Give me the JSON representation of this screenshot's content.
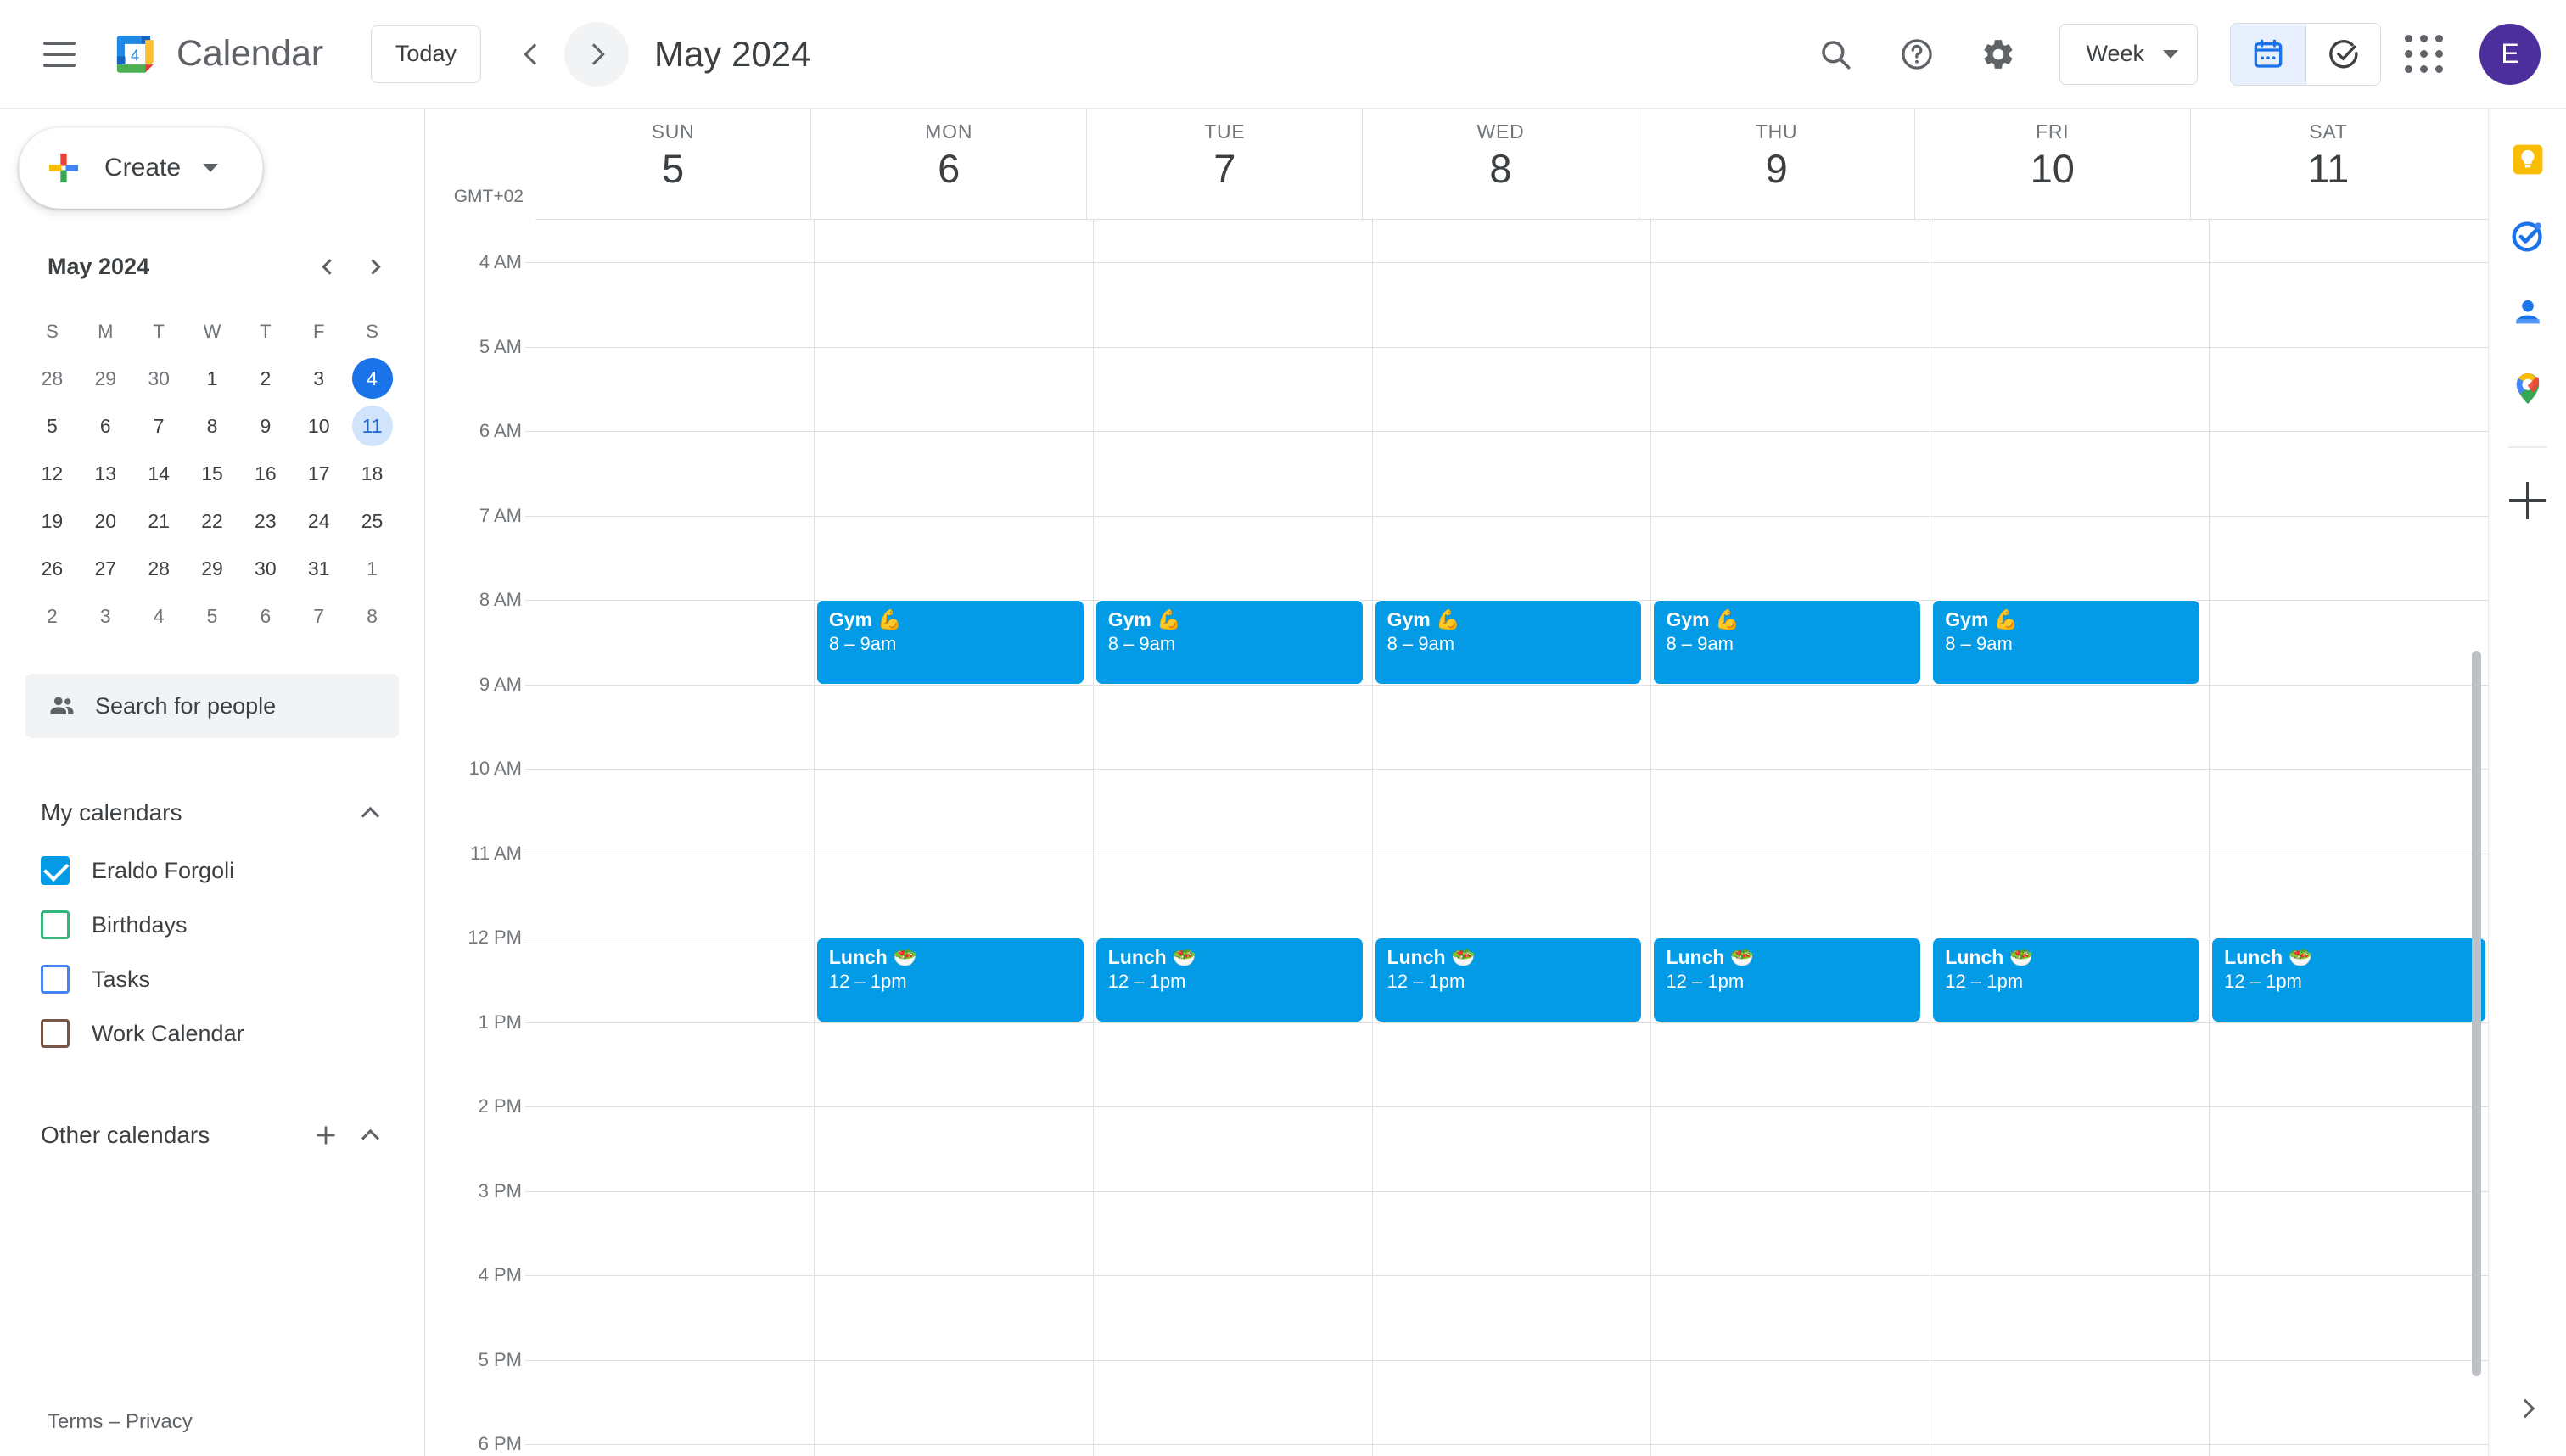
{
  "app": {
    "brand_title": "Calendar",
    "logo_day": "4"
  },
  "topbar": {
    "menu_icon": "hamburger-menu-icon",
    "today_label": "Today",
    "prev_icon": "chevron-left-icon",
    "next_icon": "chevron-right-icon",
    "period_title": "May 2024",
    "search_icon": "search-icon",
    "help_icon": "help-circle-icon",
    "settings_icon": "gear-icon",
    "view_label": "Week",
    "view_caret_icon": "chevron-down-icon",
    "calendar_view_icon": "calendar-icon",
    "tasks_view_icon": "check-circle-icon",
    "apps_icon": "apps-grid-icon",
    "avatar_initial": "E",
    "avatar_color": "#4c2e9c"
  },
  "sidebar": {
    "create_label": "Create",
    "create_caret_icon": "chevron-down-icon",
    "mini_calendar": {
      "title": "May 2024",
      "prev_icon": "chevron-left-icon",
      "next_icon": "chevron-right-icon",
      "dow": [
        "S",
        "M",
        "T",
        "W",
        "T",
        "F",
        "S"
      ],
      "weeks": [
        [
          {
            "d": "28",
            "s": "other"
          },
          {
            "d": "29",
            "s": "other"
          },
          {
            "d": "30",
            "s": "other"
          },
          {
            "d": "1",
            "s": ""
          },
          {
            "d": "2",
            "s": ""
          },
          {
            "d": "3",
            "s": ""
          },
          {
            "d": "4",
            "s": "today"
          }
        ],
        [
          {
            "d": "5",
            "s": ""
          },
          {
            "d": "6",
            "s": ""
          },
          {
            "d": "7",
            "s": ""
          },
          {
            "d": "8",
            "s": ""
          },
          {
            "d": "9",
            "s": ""
          },
          {
            "d": "10",
            "s": ""
          },
          {
            "d": "11",
            "s": "selected"
          }
        ],
        [
          {
            "d": "12",
            "s": ""
          },
          {
            "d": "13",
            "s": ""
          },
          {
            "d": "14",
            "s": ""
          },
          {
            "d": "15",
            "s": ""
          },
          {
            "d": "16",
            "s": ""
          },
          {
            "d": "17",
            "s": ""
          },
          {
            "d": "18",
            "s": ""
          }
        ],
        [
          {
            "d": "19",
            "s": ""
          },
          {
            "d": "20",
            "s": ""
          },
          {
            "d": "21",
            "s": ""
          },
          {
            "d": "22",
            "s": ""
          },
          {
            "d": "23",
            "s": ""
          },
          {
            "d": "24",
            "s": ""
          },
          {
            "d": "25",
            "s": ""
          }
        ],
        [
          {
            "d": "26",
            "s": ""
          },
          {
            "d": "27",
            "s": ""
          },
          {
            "d": "28",
            "s": ""
          },
          {
            "d": "29",
            "s": ""
          },
          {
            "d": "30",
            "s": ""
          },
          {
            "d": "31",
            "s": ""
          },
          {
            "d": "1",
            "s": "other"
          }
        ],
        [
          {
            "d": "2",
            "s": "other"
          },
          {
            "d": "3",
            "s": "other"
          },
          {
            "d": "4",
            "s": "other"
          },
          {
            "d": "5",
            "s": "other"
          },
          {
            "d": "6",
            "s": "other"
          },
          {
            "d": "7",
            "s": "other"
          },
          {
            "d": "8",
            "s": "other"
          }
        ]
      ]
    },
    "people_search": {
      "label": "Search for people",
      "icon": "people-icon"
    },
    "my_calendars": {
      "title": "My calendars",
      "collapse_icon": "chevron-up-icon",
      "items": [
        {
          "label": "Eraldo Forgoli",
          "color": "#039be5",
          "checked": true
        },
        {
          "label": "Birthdays",
          "color": "#33b679",
          "checked": false
        },
        {
          "label": "Tasks",
          "color": "#4285f4",
          "checked": false
        },
        {
          "label": "Work Calendar",
          "color": "#795548",
          "checked": false
        }
      ]
    },
    "other_calendars": {
      "title": "Other calendars",
      "add_icon": "plus-icon",
      "collapse_icon": "chevron-up-icon",
      "items": []
    },
    "footer": {
      "terms": "Terms",
      "separator": "–",
      "privacy": "Privacy"
    }
  },
  "grid": {
    "timezone": "GMT+02",
    "days": [
      {
        "dow": "SUN",
        "num": "5"
      },
      {
        "dow": "MON",
        "num": "6"
      },
      {
        "dow": "TUE",
        "num": "7"
      },
      {
        "dow": "WED",
        "num": "8"
      },
      {
        "dow": "THU",
        "num": "9"
      },
      {
        "dow": "FRI",
        "num": "10"
      },
      {
        "dow": "SAT",
        "num": "11"
      }
    ],
    "hours": [
      "4 AM",
      "5 AM",
      "6 AM",
      "7 AM",
      "8 AM",
      "9 AM",
      "10 AM",
      "11 AM",
      "12 PM",
      "1 PM",
      "2 PM",
      "3 PM",
      "4 PM",
      "5 PM",
      "6 PM"
    ],
    "events": [
      {
        "day": 1,
        "title": "Gym 💪",
        "time": "8 – 9am",
        "start_hour": "8 AM",
        "end_hour": "9 AM",
        "color": "#039be5",
        "full_width": false
      },
      {
        "day": 2,
        "title": "Gym 💪",
        "time": "8 – 9am",
        "start_hour": "8 AM",
        "end_hour": "9 AM",
        "color": "#039be5",
        "full_width": false
      },
      {
        "day": 3,
        "title": "Gym 💪",
        "time": "8 – 9am",
        "start_hour": "8 AM",
        "end_hour": "9 AM",
        "color": "#039be5",
        "full_width": false
      },
      {
        "day": 4,
        "title": "Gym 💪",
        "time": "8 – 9am",
        "start_hour": "8 AM",
        "end_hour": "9 AM",
        "color": "#039be5",
        "full_width": false
      },
      {
        "day": 5,
        "title": "Gym 💪",
        "time": "8 – 9am",
        "start_hour": "8 AM",
        "end_hour": "9 AM",
        "color": "#039be5",
        "full_width": false
      },
      {
        "day": 1,
        "title": "Lunch 🥗",
        "time": "12 – 1pm",
        "start_hour": "12 PM",
        "end_hour": "1 PM",
        "color": "#039be5",
        "full_width": false
      },
      {
        "day": 2,
        "title": "Lunch 🥗",
        "time": "12 – 1pm",
        "start_hour": "12 PM",
        "end_hour": "1 PM",
        "color": "#039be5",
        "full_width": false
      },
      {
        "day": 3,
        "title": "Lunch 🥗",
        "time": "12 – 1pm",
        "start_hour": "12 PM",
        "end_hour": "1 PM",
        "color": "#039be5",
        "full_width": false
      },
      {
        "day": 4,
        "title": "Lunch 🥗",
        "time": "12 – 1pm",
        "start_hour": "12 PM",
        "end_hour": "1 PM",
        "color": "#039be5",
        "full_width": false
      },
      {
        "day": 5,
        "title": "Lunch 🥗",
        "time": "12 – 1pm",
        "start_hour": "12 PM",
        "end_hour": "1 PM",
        "color": "#039be5",
        "full_width": false
      },
      {
        "day": 6,
        "title": "Lunch 🥗",
        "time": "12 – 1pm",
        "start_hour": "12 PM",
        "end_hour": "1 PM",
        "color": "#039be5",
        "full_width": true
      }
    ]
  },
  "rail": {
    "items": [
      {
        "icon": "google-keep-icon",
        "name": "keep"
      },
      {
        "icon": "google-tasks-icon",
        "name": "tasks"
      },
      {
        "icon": "google-contacts-icon",
        "name": "contacts"
      },
      {
        "icon": "google-maps-icon",
        "name": "maps"
      }
    ],
    "add_icon": "plus-icon",
    "expand_icon": "chevron-right-icon"
  }
}
